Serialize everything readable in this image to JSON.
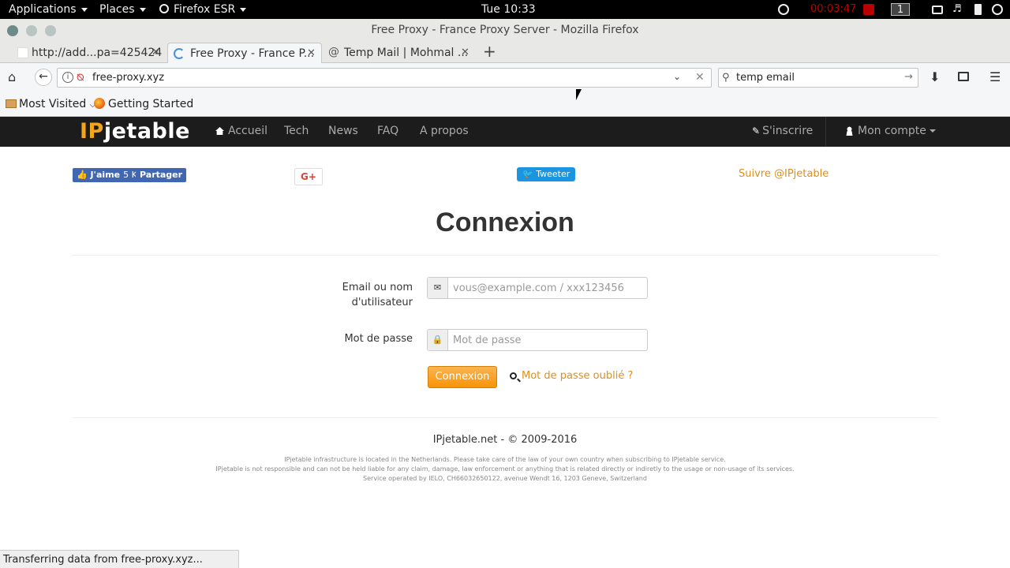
{
  "os_topbar": {
    "applications": "Applications",
    "places": "Places",
    "firefox": "Firefox ESR",
    "clock": "Tue 10:33",
    "timer": "00:03:47",
    "workspace": "1"
  },
  "window": {
    "title": "Free Proxy - France Proxy Server - Mozilla Firefox"
  },
  "tabs": [
    {
      "label": "http://add...pa=425424"
    },
    {
      "label": "Free Proxy - France P..."
    },
    {
      "label": "Temp Mail | Mohmal ..."
    }
  ],
  "urlbar": {
    "value": "free-proxy.xyz"
  },
  "searchbar": {
    "value": "temp email"
  },
  "bookmarks": [
    {
      "label": "Most Visited"
    },
    {
      "label": "Getting Started"
    }
  ],
  "site": {
    "logo_ip": "IP",
    "logo_rest": "jetable",
    "nav": [
      "Accueil",
      "Tech",
      "News",
      "FAQ",
      "A propos"
    ],
    "signup": "S'inscrire",
    "account": "Mon compte"
  },
  "social": {
    "fb_like": "J'aime",
    "fb_count": "5 K",
    "fb_share": "Partager",
    "gplus": "G+",
    "tweet": "Tweeter",
    "follow": "Suivre @IPjetable"
  },
  "login": {
    "heading": "Connexion",
    "email_label_1": "Email ou nom",
    "email_label_2": "d'utilisateur",
    "email_placeholder": "vous@example.com / xxx123456",
    "password_label": "Mot de passe",
    "password_placeholder": "Mot de passe",
    "submit": "Connexion",
    "forgot": "Mot de passe oublié ?"
  },
  "footer": {
    "copyright": "IPjetable.net - © 2009-2016",
    "line1": "IPjetable infrastructure is located in the Netherlands. Please take care of the law of your own country when subscribing to IPjetable service.",
    "line2": "IPjetable is not responsible and can not be held liable for any claim, damage, law enforcement or anything that is related directly or indiretly to the usage or non-usage of its services.",
    "line3": "Service operated by IELO, CH66032650122, avenue Wendt 16, 1203 Geneve, Switzerland"
  },
  "statusbar": {
    "text": "Transferring data from free-proxy.xyz..."
  }
}
